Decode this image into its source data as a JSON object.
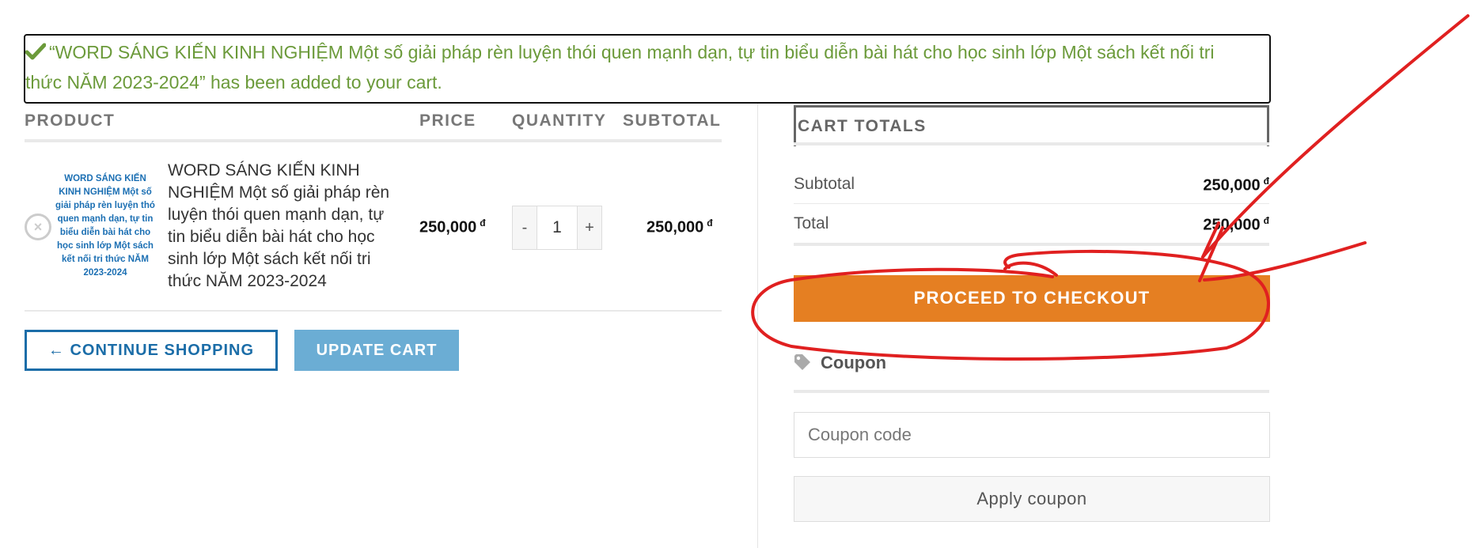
{
  "notice": {
    "line1": "“WORD SÁNG KIẾN KINH NGHIỆM Một số giải pháp rèn luyện thói quen mạnh dạn, tự tin biểu diễn bài hát cho học sinh lớp Một sách kết nối tri",
    "line2": "thức NĂM 2023-2024” has been added to your cart.",
    "color": "#6b9a3a"
  },
  "table": {
    "headers": {
      "product": "PRODUCT",
      "price": "PRICE",
      "quantity": "QUANTITY",
      "subtotal": "SUBTOTAL"
    },
    "remove_symbol": "×",
    "rows": [
      {
        "thumbnail_lines": [
          "WORD SÁNG KIẾN",
          "KINH NGHIỆM Một số",
          "giải pháp rèn luyện thói",
          "quen mạnh dạn, tự tin",
          "biểu diễn bài hát cho",
          "học sinh lớp Một sách",
          "kết nối tri thức NĂM",
          "2023-2024"
        ],
        "name": "WORD SÁNG KIẾN KINH NGHIỆM Một số giải pháp rèn luyện thói quen mạnh dạn, tự tin biểu diễn bài hát cho học sinh lớp Một sách kết nối tri thức NĂM 2023-2024",
        "price": "250,000",
        "currency": "đ",
        "qty_minus": "-",
        "qty_value": "1",
        "qty_plus": "+",
        "subtotal": "250,000"
      }
    ]
  },
  "actions": {
    "continue_shopping": "← CONTINUE SHOPPING",
    "update_cart": "UPDATE CART"
  },
  "totals": {
    "title": "CART TOTALS",
    "subtotal_label": "Subtotal",
    "subtotal_value": "250,000",
    "total_label": "Total",
    "total_value": "250,000",
    "currency": "đ",
    "checkout_label": "PROCEED TO CHECKOUT"
  },
  "coupon": {
    "title": "Coupon",
    "placeholder": "Coupon code",
    "apply_label": "Apply coupon"
  },
  "icons": {
    "notice": "checkmark-icon",
    "remove": "close-circle-icon",
    "coupon": "tag-icon"
  },
  "colors": {
    "accent_blue": "#1b6da8",
    "update_button": "#6badd4",
    "checkout_button": "#e57f22",
    "annotation_red": "#e02020"
  }
}
